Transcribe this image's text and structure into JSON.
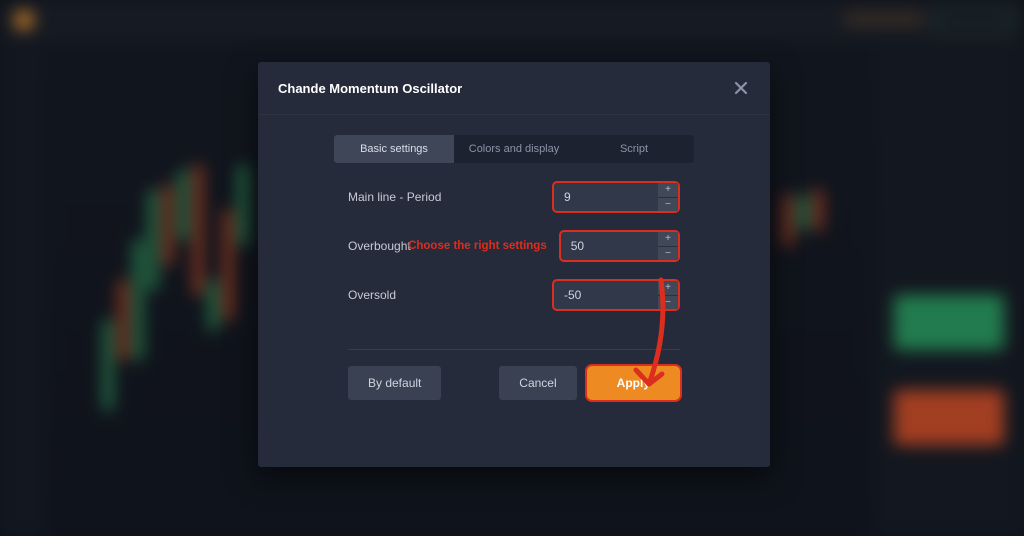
{
  "modal": {
    "title": "Chande Momentum Oscillator",
    "tabs": [
      "Basic settings",
      "Colors and display",
      "Script"
    ],
    "activeTab": 0,
    "settings": [
      {
        "label": "Main line - Period",
        "value": "9"
      },
      {
        "label": "Overbought",
        "value": "50"
      },
      {
        "label": "Oversold",
        "value": "-50"
      }
    ],
    "annotation": "Choose the right settings",
    "buttons": {
      "default": "By default",
      "cancel": "Cancel",
      "apply": "Apply"
    }
  },
  "colors": {
    "accent": "#ee8a22",
    "annotation": "#dc2e1e",
    "buy": "#2aa864",
    "sell": "#e15124"
  }
}
